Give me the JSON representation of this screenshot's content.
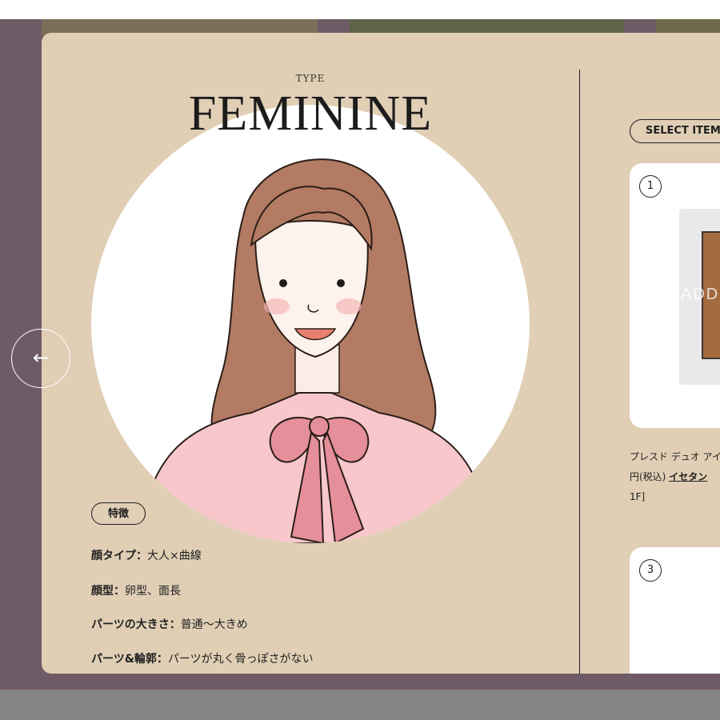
{
  "type_label": "TYPE",
  "type_name": "FEMININE",
  "features": {
    "badge": "特徴",
    "items": [
      {
        "key": "顔タイプ：",
        "value": "大人×曲線"
      },
      {
        "key": "顔型：",
        "value": "卵型、面長"
      },
      {
        "key": "パーツの大きさ：",
        "value": "普通〜大きめ"
      },
      {
        "key": "パーツ&輪郭：",
        "value": "パーツが丸く骨っぽさがない"
      }
    ]
  },
  "items_panel": {
    "select_label": "SELECT ITEM",
    "cards": [
      {
        "number": "1",
        "product_brand_text": "ADD"
      },
      {
        "number": "3"
      }
    ],
    "product_text": {
      "line1": "プレスド デュオ アイ",
      "line2_prefix": "円(税込) ",
      "line2_link": "イセタン",
      "line3": "1F]"
    }
  },
  "nav": {
    "back_arrow": "←"
  },
  "icons": {
    "back": "left-arrow-icon"
  },
  "colors": {
    "overlay": "#6f5b66",
    "modal_bg": "#e0cfb5",
    "text_dark": "#1c1c1c",
    "bottom_bar": "#858585"
  }
}
